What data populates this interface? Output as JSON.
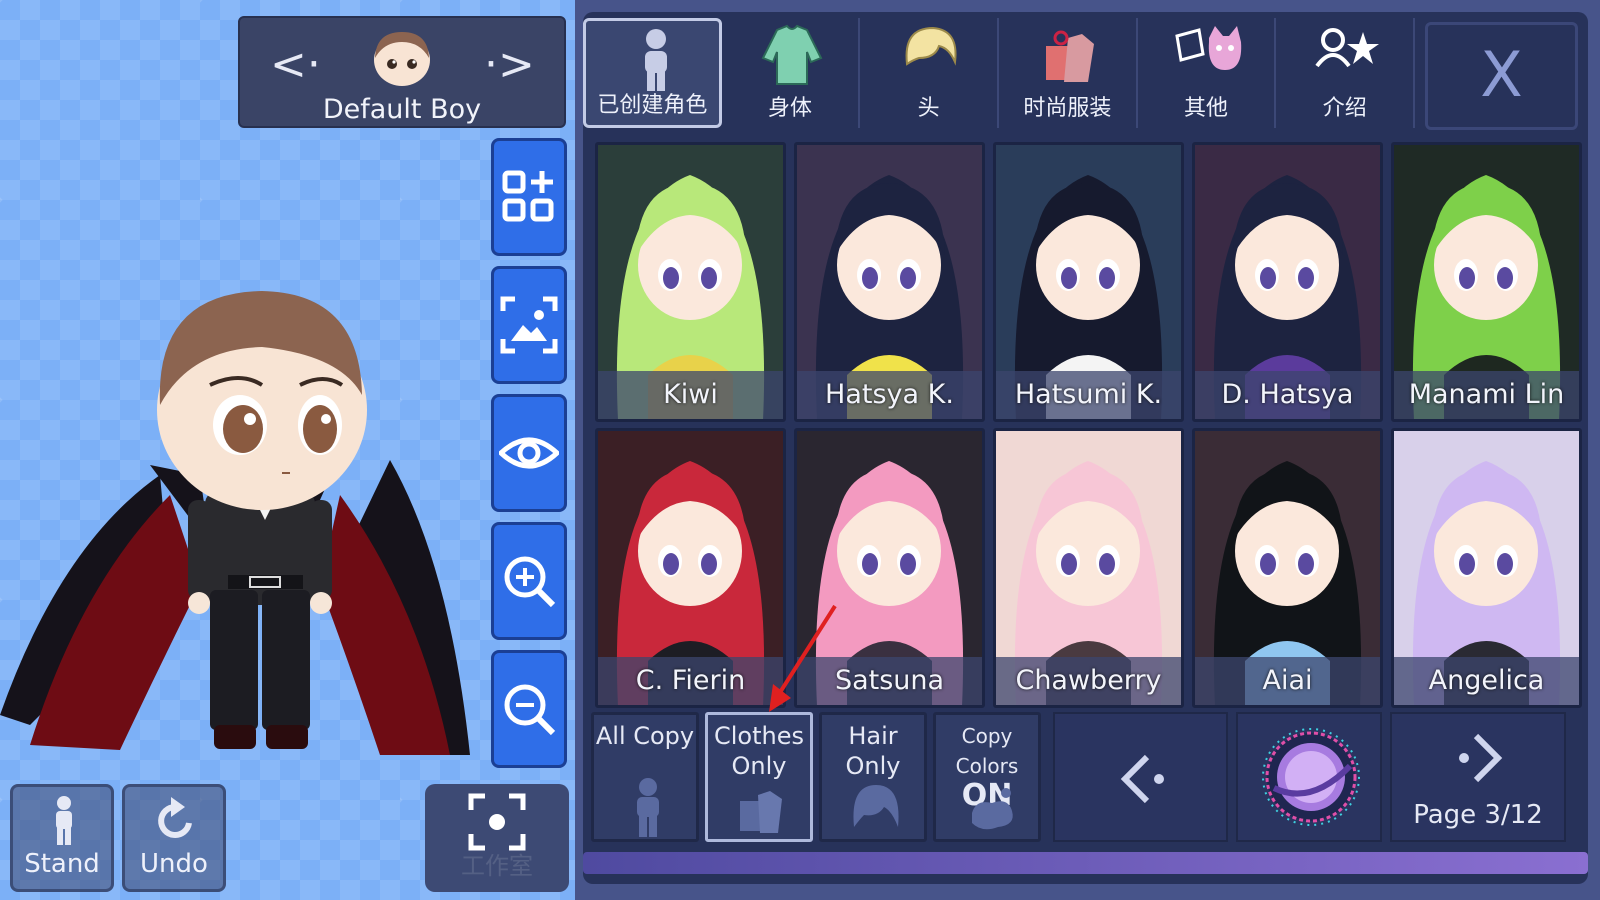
{
  "character": {
    "name": "Default Boy"
  },
  "side_tools": [
    "grid-add-icon",
    "image-capture-icon",
    "eye-icon",
    "zoom-in-icon",
    "zoom-out-icon"
  ],
  "bottom": {
    "stand_label": "Stand",
    "undo_label": "Undo",
    "studio_label": "工作室"
  },
  "tabs": [
    {
      "label": "已创建角色",
      "icon": "person-icon",
      "active": true
    },
    {
      "label": "身体",
      "icon": "shirt-icon",
      "active": false
    },
    {
      "label": "头",
      "icon": "hair-icon",
      "active": false
    },
    {
      "label": "时尚服装",
      "icon": "outfit-icon",
      "active": false
    },
    {
      "label": "其他",
      "icon": "cat-box-icon",
      "active": false
    },
    {
      "label": "介绍",
      "icon": "profile-star-icon",
      "active": false
    }
  ],
  "close_label": "X",
  "presets": [
    {
      "name": "Kiwi",
      "hair": "#b8e87a",
      "bg": "#2b3e3a",
      "outfit": "#e8d24a"
    },
    {
      "name": "Hatsya K.",
      "hair": "#1d2340",
      "bg": "#3b3350",
      "outfit": "#f0e24a"
    },
    {
      "name": "Hatsumi K.",
      "hair": "#161a2e",
      "bg": "#2a3d5a",
      "outfit": "#f4f4f4"
    },
    {
      "name": "D. Hatsya",
      "hair": "#1d2340",
      "bg": "#3a2a45",
      "outfit": "#5b3b9c"
    },
    {
      "name": "Manami Lin",
      "hair": "#7ed04a",
      "bg": "#1f2a25",
      "outfit": "#1e2820"
    },
    {
      "name": "C. Fierin",
      "hair": "#c9283b",
      "bg": "#3b1f25",
      "outfit": "#1d1d24"
    },
    {
      "name": "Satsuna",
      "hair": "#f39ac0",
      "bg": "#2a2630",
      "outfit": "#3a3040"
    },
    {
      "name": "Chawberry",
      "hair": "#f7c6d6",
      "bg": "#f0d8d4",
      "outfit": "#4a3a40"
    },
    {
      "name": "Aiai",
      "hair": "#111418",
      "bg": "#3a2c36",
      "outfit": "#8fc6f0"
    },
    {
      "name": "Angelica",
      "hair": "#cfb8f2",
      "bg": "#d8d0ea",
      "outfit": "#2a2a33"
    }
  ],
  "copy_options": {
    "all_copy": "All Copy",
    "clothes_line1": "Clothes",
    "clothes_line2": "Only",
    "hair_line1": "Hair",
    "hair_line2": "Only",
    "copy_colors": "Copy Colors",
    "copy_colors_state": "ON"
  },
  "pagination": {
    "page": "Page 3/12"
  },
  "colors": {
    "accent": "#2f6ee8",
    "panel": "#27325a",
    "annotation_arrow": "#e02020"
  }
}
